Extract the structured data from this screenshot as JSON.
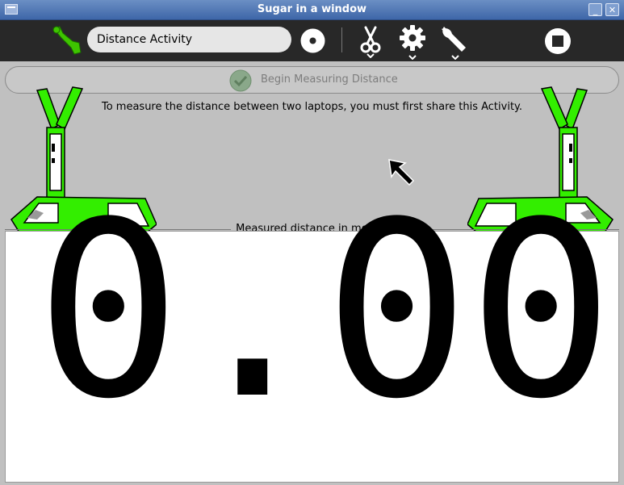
{
  "window": {
    "title": "Sugar in a window",
    "minimize_label": "_",
    "close_label": "✕"
  },
  "toolbar": {
    "activity_name": "Distance Activity",
    "icons": [
      "activity-icon",
      "record-icon",
      "cut-icon",
      "settings-icon",
      "wrench-icon",
      "stop-icon"
    ]
  },
  "main": {
    "begin_button_label": "Begin Measuring Distance",
    "instructions": "To measure the distance between two laptops, you must first share this Activity.",
    "frame_label": "Measured distance in meters",
    "distance_value": "0.00"
  },
  "colors": {
    "toolbar_bg": "#282828",
    "laptop_green": "#33ee00",
    "content_bg": "#c0c0c0"
  }
}
